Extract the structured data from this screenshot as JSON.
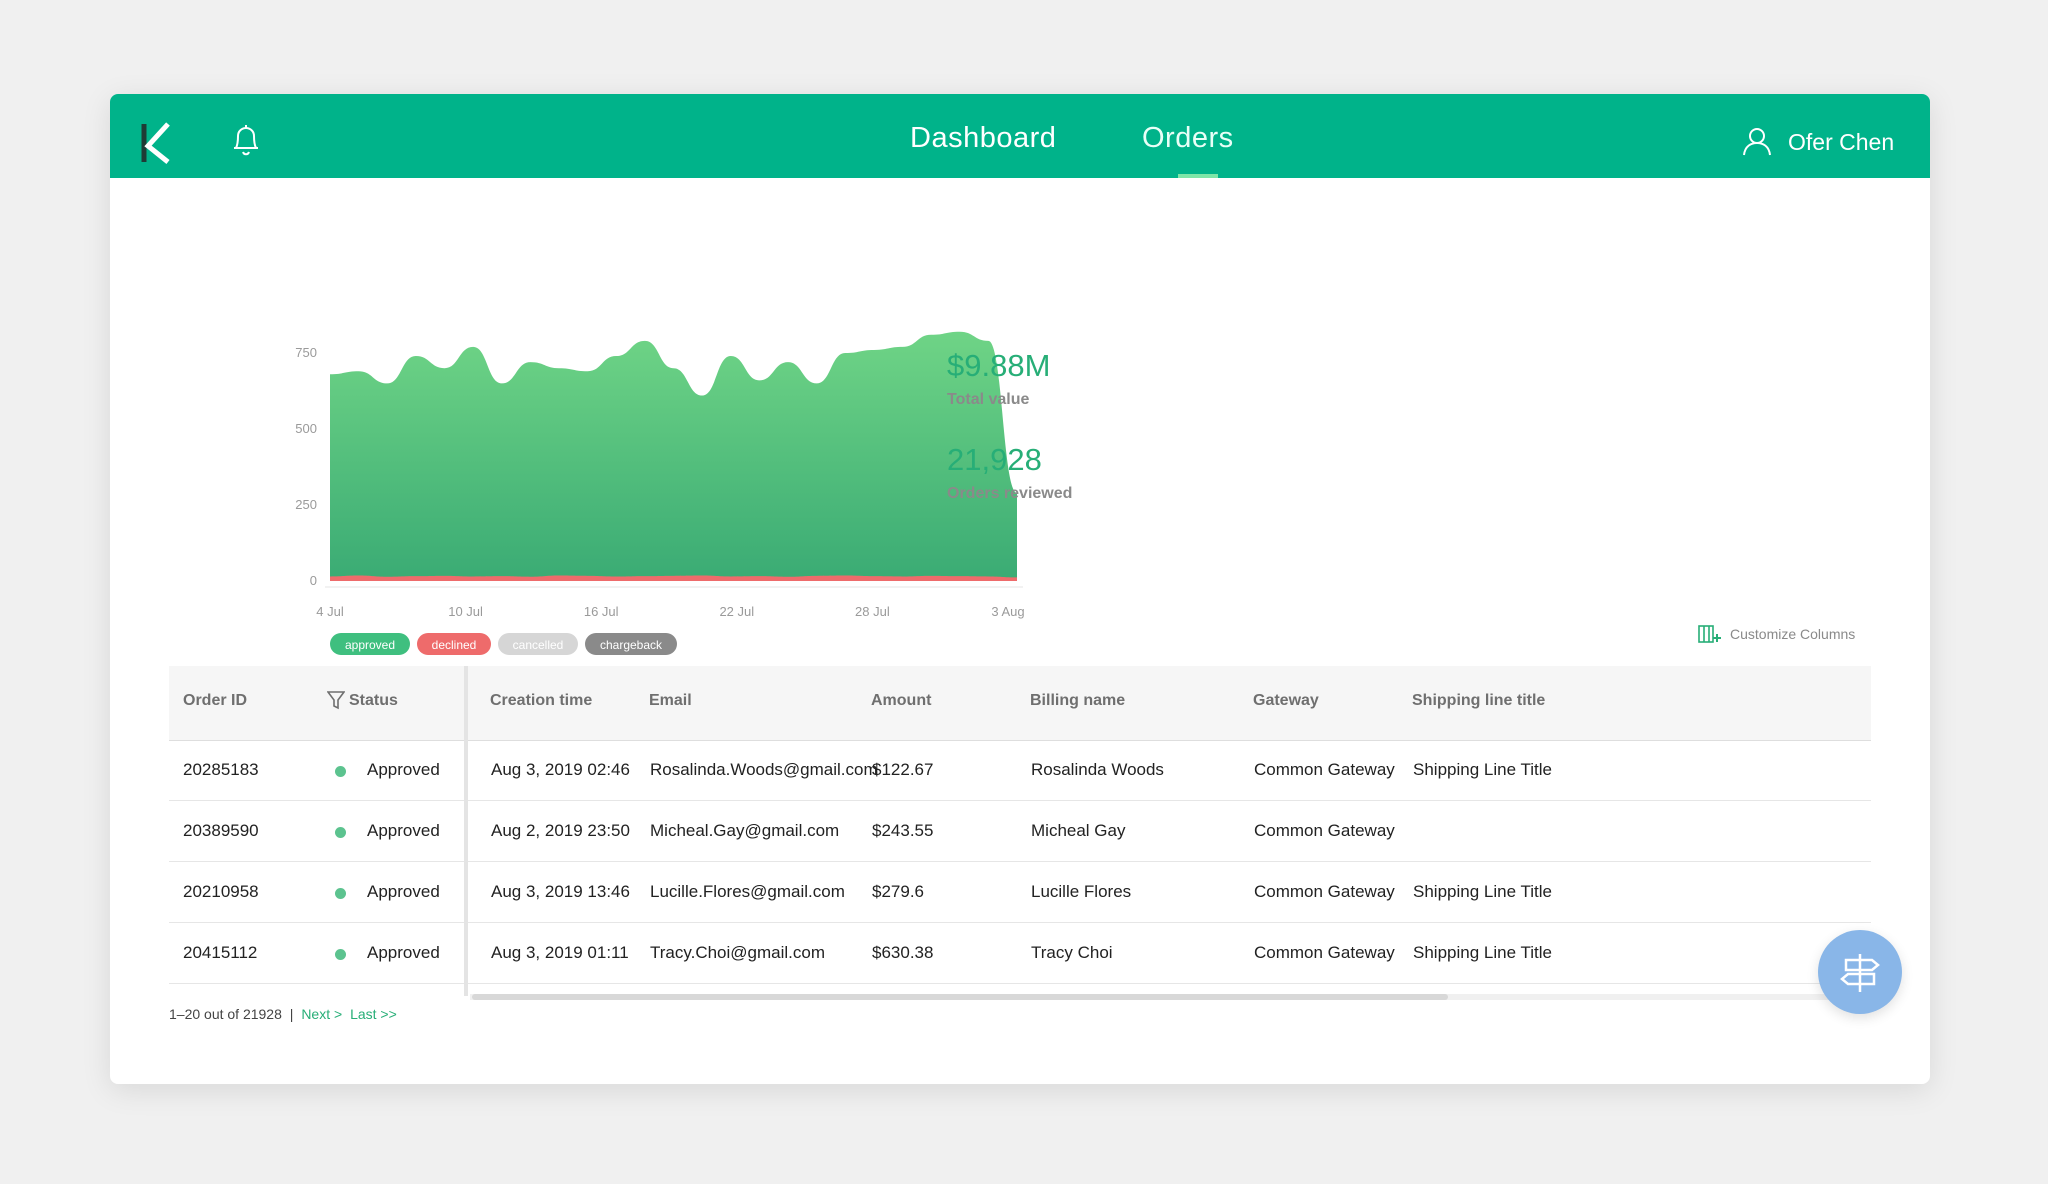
{
  "header": {
    "nav": {
      "dashboard": "Dashboard",
      "orders": "Orders"
    },
    "user": {
      "name": "Ofer Chen"
    },
    "accent_color": "#00b38a"
  },
  "chart_data": {
    "type": "area",
    "title": "",
    "x": [
      "4 Jul",
      "10 Jul",
      "16 Jul",
      "22 Jul",
      "28 Jul",
      "3 Aug"
    ],
    "y_ticks": [
      "750",
      "500",
      "250",
      "0"
    ],
    "ylim": [
      0,
      750
    ],
    "series": [
      {
        "name": "approved",
        "color": "#3fbf7f",
        "values": [
          680,
          690,
          650,
          740,
          700,
          770,
          650,
          720,
          700,
          690,
          740,
          790,
          700,
          610,
          740,
          660,
          720,
          650,
          750,
          760,
          770,
          810,
          820,
          790,
          290
        ]
      },
      {
        "name": "declined",
        "color": "#ee6b6b",
        "values": [
          15,
          18,
          14,
          16,
          17,
          15,
          16,
          14,
          18,
          17,
          15,
          16,
          17,
          18,
          15,
          16,
          14,
          17,
          18,
          16,
          15,
          17,
          16,
          15,
          12
        ]
      }
    ],
    "legend": [
      {
        "label": "approved",
        "color": "#3fbf7f",
        "text_color": "#ffffff"
      },
      {
        "label": "declined",
        "color": "#ee6b6b",
        "text_color": "#ffffff"
      },
      {
        "label": "cancelled",
        "color": "#d6d6d6",
        "text_color": "#ffffff"
      },
      {
        "label": "chargeback",
        "color": "#8a8a8a",
        "text_color": "#ffffff"
      }
    ],
    "legend_position": "bottom-left"
  },
  "kpis": {
    "total_value": "$9.88M",
    "total_value_label": "Total value",
    "orders_reviewed": "21,928",
    "orders_reviewed_label": "Orders reviewed"
  },
  "table": {
    "customize_label": "Customize Columns",
    "columns": [
      "Order ID",
      "Status",
      "Creation time",
      "Email",
      "Amount",
      "Billing name",
      "Gateway",
      "Shipping line title"
    ],
    "rows": [
      {
        "order_id": "20285183",
        "status": "Approved",
        "created": "Aug 3, 2019 02:46",
        "email": "Rosalinda.Woods@gmail.com",
        "amount": "$122.67",
        "billing": "Rosalinda Woods",
        "gateway": "Common Gateway",
        "shipping": "Shipping Line Title"
      },
      {
        "order_id": "20389590",
        "status": "Approved",
        "created": "Aug 2, 2019 23:50",
        "email": "Micheal.Gay@gmail.com",
        "amount": "$243.55",
        "billing": "Micheal Gay",
        "gateway": "Common Gateway",
        "shipping": ""
      },
      {
        "order_id": "20210958",
        "status": "Approved",
        "created": "Aug 3, 2019 13:46",
        "email": "Lucille.Flores@gmail.com",
        "amount": "$279.6",
        "billing": "Lucille Flores",
        "gateway": "Common Gateway",
        "shipping": "Shipping Line Title"
      },
      {
        "order_id": "20415112",
        "status": "Approved",
        "created": "Aug 3, 2019 01:11",
        "email": "Tracy.Choi@gmail.com",
        "amount": "$630.38",
        "billing": "Tracy Choi",
        "gateway": "Common Gateway",
        "shipping": "Shipping Line Title"
      }
    ]
  },
  "pager": {
    "range": "1–20 out of 21928",
    "sep": "|",
    "next": "Next >",
    "last": "Last >>"
  }
}
